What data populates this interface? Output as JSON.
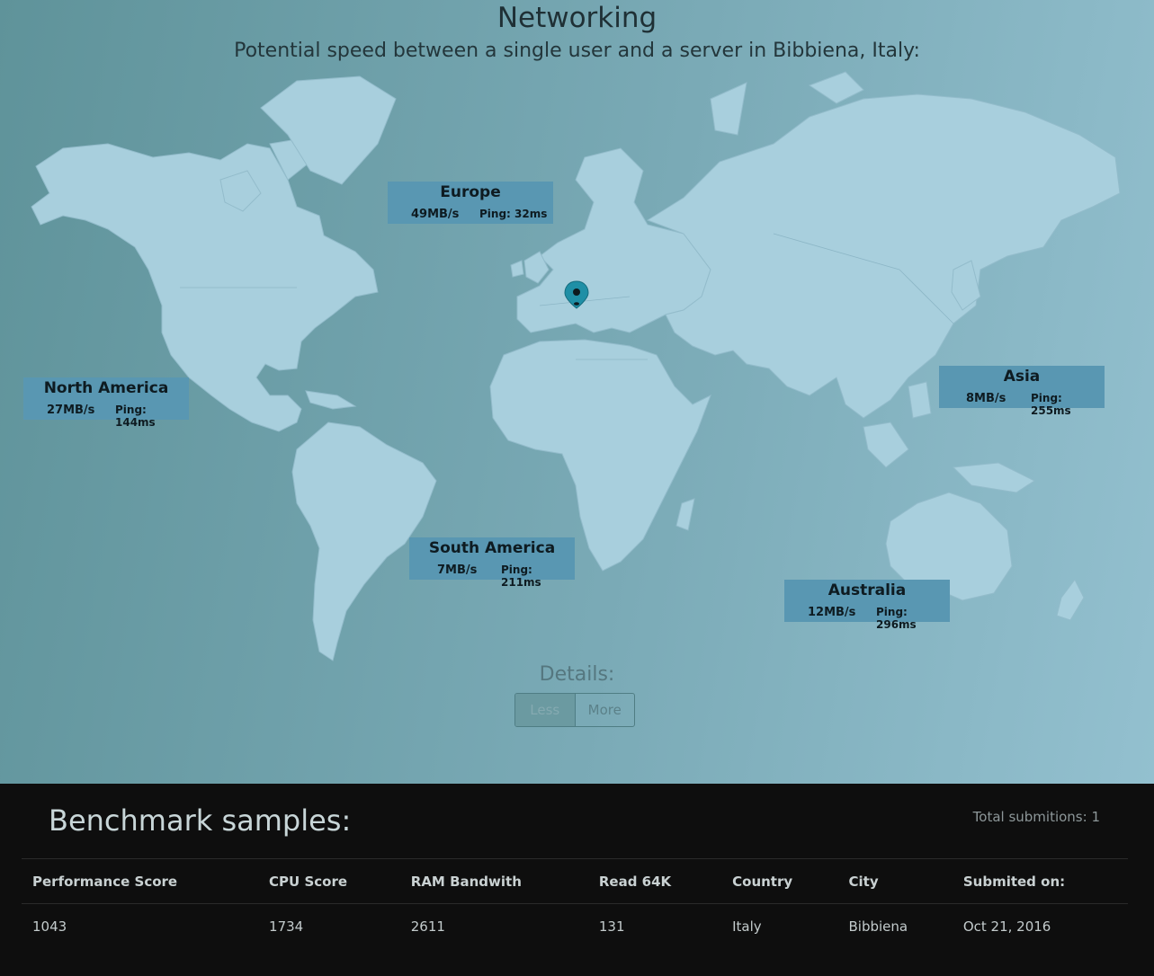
{
  "networking": {
    "title": "Networking",
    "subtitle": "Potential speed between a single user and a server in Bibbiena, Italy:",
    "marker_icon": "map-pin-icon",
    "regions": {
      "europe": {
        "name": "Europe",
        "speed": "49MB/s",
        "ping": "Ping: 32ms"
      },
      "north_america": {
        "name": "North America",
        "speed": "27MB/s",
        "ping": "Ping: 144ms"
      },
      "asia": {
        "name": "Asia",
        "speed": "8MB/s",
        "ping": "Ping: 255ms"
      },
      "south_america": {
        "name": "South America",
        "speed": "7MB/s",
        "ping": "Ping: 211ms"
      },
      "australia": {
        "name": "Australia",
        "speed": "12MB/s",
        "ping": "Ping: 296ms"
      }
    },
    "details": {
      "label": "Details:",
      "options": [
        "Less",
        "More"
      ],
      "selected": "Less"
    }
  },
  "benchmark": {
    "title": "Benchmark samples:",
    "total": "Total submitions: 1",
    "columns": [
      "Performance Score",
      "CPU Score",
      "RAM Bandwith",
      "Read 64K",
      "Country",
      "City",
      "Submited on:"
    ],
    "rows": [
      [
        "1043",
        "1734",
        "2611",
        "131",
        "Italy",
        "Bibbiena",
        "Oct 21, 2016"
      ]
    ]
  },
  "colors": {
    "region_box": "#5997b2",
    "land": "#a8cfdd",
    "dark_bg": "#0e0e0e"
  }
}
